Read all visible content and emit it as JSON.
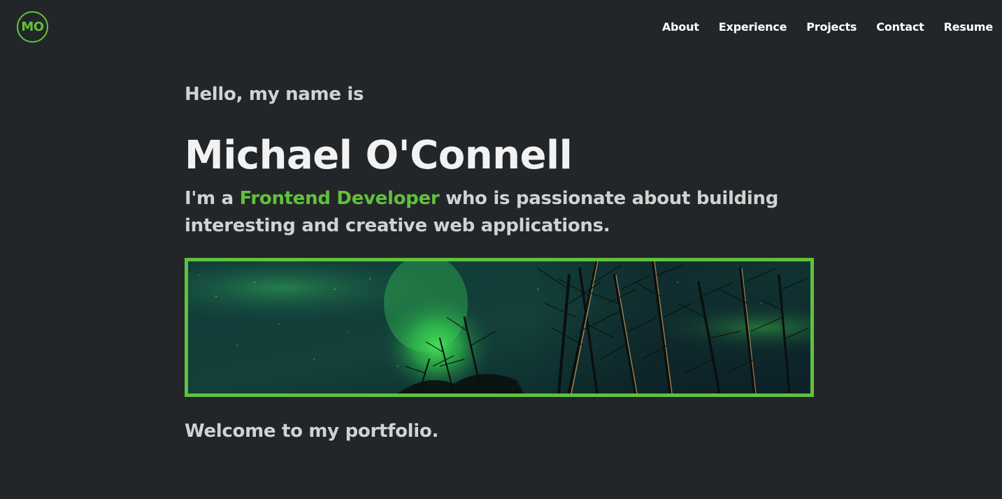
{
  "logo": {
    "text": "MO"
  },
  "nav": {
    "items": [
      {
        "label": "About"
      },
      {
        "label": "Experience"
      },
      {
        "label": "Projects"
      },
      {
        "label": "Contact"
      },
      {
        "label": "Resume"
      }
    ]
  },
  "hero": {
    "greeting": "Hello, my name is",
    "name": "Michael O'Connell",
    "tagline_prefix": "I'm a ",
    "tagline_highlight": "Frontend Developer",
    "tagline_suffix": " who is passionate about building interesting and creative web applications."
  },
  "banner": {
    "image_subject": "aurora-borealis-over-trees"
  },
  "welcome": {
    "text": "Welcome to my portfolio."
  },
  "colors": {
    "background": "#222629",
    "accent": "#61c13c",
    "heading": "#f2f2f2",
    "text": "#d2d2d2",
    "nav_text": "#ffffff"
  }
}
